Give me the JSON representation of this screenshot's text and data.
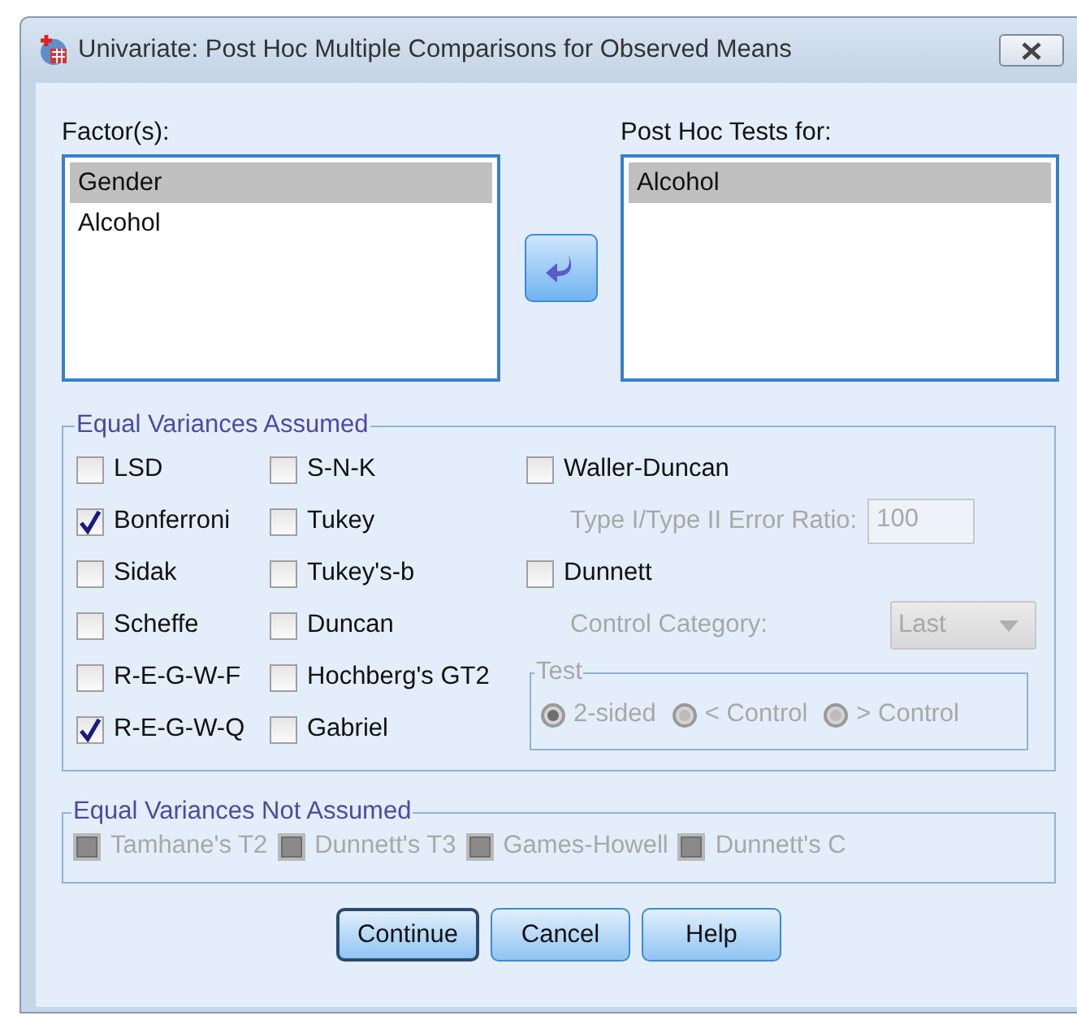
{
  "window": {
    "title": "Univariate: Post Hoc Multiple Comparisons for Observed Means"
  },
  "factors": {
    "label": "Factor(s):",
    "items": [
      {
        "label": "Gender",
        "selected": true
      },
      {
        "label": "Alcohol",
        "selected": false
      }
    ]
  },
  "post_hoc_for": {
    "label": "Post Hoc Tests for:",
    "items": [
      {
        "label": "Alcohol",
        "selected": true
      }
    ]
  },
  "equal_variances_assumed": {
    "title": "Equal Variances Assumed",
    "column_1": [
      {
        "label": "LSD",
        "checked": false
      },
      {
        "label": "Bonferroni",
        "checked": true
      },
      {
        "label": "Sidak",
        "checked": false
      },
      {
        "label": "Scheffe",
        "checked": false
      },
      {
        "label": "R-E-G-W-F",
        "checked": false
      },
      {
        "label": "R-E-G-W-Q",
        "checked": true
      }
    ],
    "column_2": [
      {
        "label": "S-N-K",
        "checked": false
      },
      {
        "label": "Tukey",
        "checked": false
      },
      {
        "label": "Tukey's-b",
        "checked": false
      },
      {
        "label": "Duncan",
        "checked": false
      },
      {
        "label": "Hochberg's GT2",
        "checked": false
      },
      {
        "label": "Gabriel",
        "checked": false
      }
    ],
    "waller_duncan": {
      "label": "Waller-Duncan",
      "checked": false
    },
    "error_ratio": {
      "label": "Type I/Type II Error Ratio:",
      "value": "100",
      "disabled": true
    },
    "dunnett": {
      "label": "Dunnett",
      "checked": false
    },
    "control_category": {
      "label": "Control Category:",
      "value": "Last",
      "disabled": true
    },
    "test": {
      "title": "Test",
      "options": [
        {
          "label": "2-sided",
          "selected": true,
          "disabled": true
        },
        {
          "label": "< Control",
          "selected": false,
          "disabled": true
        },
        {
          "label": "> Control",
          "selected": false,
          "disabled": true
        }
      ]
    }
  },
  "equal_variances_not_assumed": {
    "title": "Equal Variances Not Assumed",
    "tests": [
      {
        "label": "Tamhane's T2",
        "checked": false,
        "disabled": true
      },
      {
        "label": "Dunnett's T3",
        "checked": false,
        "disabled": true
      },
      {
        "label": "Games-Howell",
        "checked": false,
        "disabled": true
      },
      {
        "label": "Dunnett's C",
        "checked": false,
        "disabled": true
      }
    ]
  },
  "buttons": [
    {
      "label": "Continue",
      "default": true
    },
    {
      "label": "Cancel",
      "default": false
    },
    {
      "label": "Help",
      "default": false
    }
  ]
}
